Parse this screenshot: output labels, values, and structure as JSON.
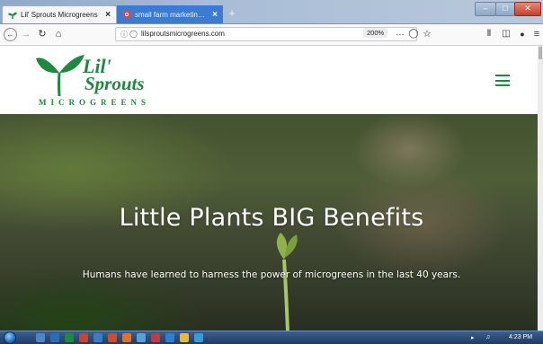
{
  "browser": {
    "tabs": [
      {
        "title": "Lil' Sprouts Microgreens",
        "close": "×",
        "active": true
      },
      {
        "title": "small farm marketing logo - G",
        "close": "×",
        "active": false
      }
    ],
    "new_tab": "+",
    "url": "lilsproutsmicrogreens.com",
    "zoom": "200%",
    "page_actions": "···",
    "window_controls": {
      "minimize": "–",
      "maximize": "□",
      "close": "✕"
    }
  },
  "site": {
    "logo": {
      "line1": "Lil'",
      "line2": "Sprouts",
      "line3": "MICROGREENS"
    },
    "hero": {
      "title": "Little Plants BIG Benefits",
      "subtitle": "Humans have learned to harness the power of microgreens in the last 40 years."
    }
  },
  "taskbar": {
    "clock": "4:23 PM"
  },
  "colors": {
    "brand_green": "#1e8a3e",
    "tab_active_bg": "#f5f6f7",
    "tab_inactive_bg": "#3c7bd2"
  },
  "icons": [
    "back-icon",
    "forward-icon",
    "reload-icon",
    "home-icon",
    "info-icon",
    "tracking-shield-icon",
    "pocket-icon",
    "bookmark-star-icon",
    "library-icon",
    "sidebar-icon",
    "extension-icon",
    "menu-icon",
    "hamburger-menu-icon"
  ]
}
